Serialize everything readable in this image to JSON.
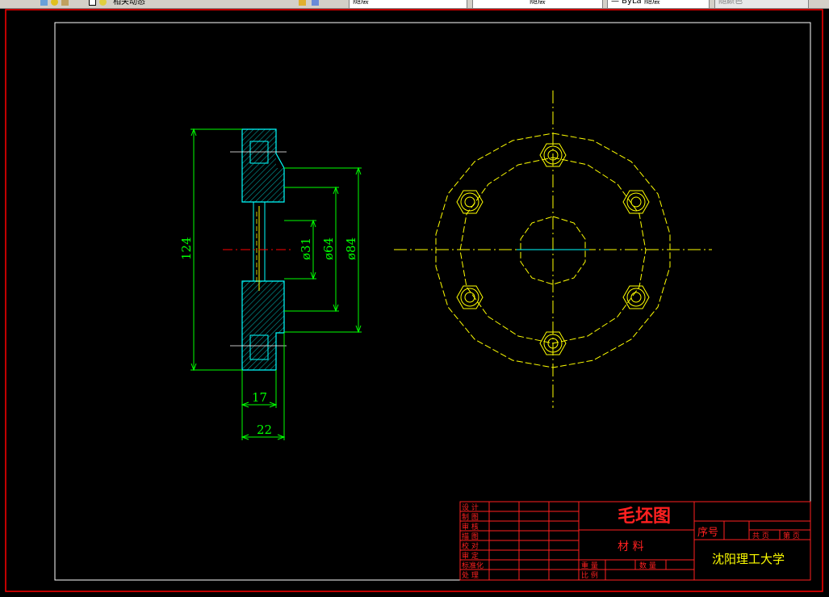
{
  "toolbar": {
    "layer_name": "相关动态",
    "style_name": "随层",
    "linetype_name": "随层",
    "lineweight_name": "— ByLa 随层",
    "plotstyle_name": "随颜色"
  },
  "dimensions": {
    "d124": "124",
    "d31": "ø31",
    "d64": "ø64",
    "d84": "ø84",
    "d17": "17",
    "d22": "22"
  },
  "title_block": {
    "drawing_title": "毛坯图",
    "material_label": "材 料",
    "sequence_label": "序号",
    "sheet_total": "共 页",
    "sheet_num": "第 页",
    "school": "沈阳理工大学",
    "quantity_label": "重 量",
    "count_label": "数 量",
    "scale_label": "比 例",
    "rows": [
      "设 计",
      "制 图",
      "审 核",
      "描 图",
      "校 对",
      "审 定",
      "标准化",
      "处 理"
    ]
  },
  "colors": {
    "frame": "#ffffff",
    "border": "#ff0000",
    "geometry": "#00ffff",
    "dimension": "#00ff00",
    "centerline": "#ffff00",
    "hatch": "#00aaaa",
    "titleblock": "#ff2020"
  }
}
